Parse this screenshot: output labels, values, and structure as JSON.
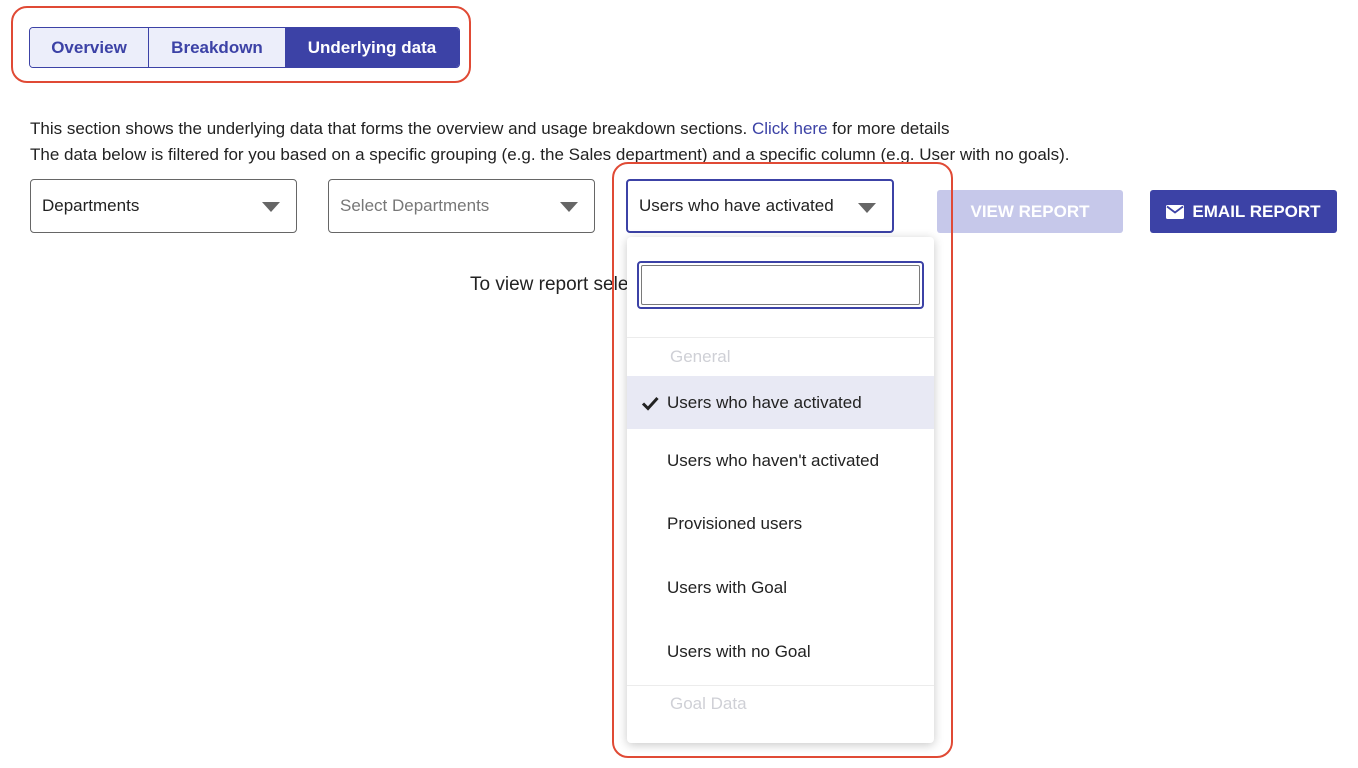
{
  "tabs": {
    "overview": "Overview",
    "breakdown": "Breakdown",
    "underlying": "Underlying data"
  },
  "description": {
    "line1_before": "This section shows the underlying data that forms the overview and usage breakdown sections.",
    "link": "Click here",
    "line1_after": "for more details",
    "line2": "The data below is filtered for you based on a specific grouping (e.g. the Sales department) and a specific column (e.g. User with no goals)."
  },
  "filters": {
    "grouping": "Departments",
    "group_value_placeholder": "Select Departments",
    "column": "Users who have activated"
  },
  "buttons": {
    "view_report": "VIEW REPORT",
    "email_report": "EMAIL REPORT"
  },
  "hint": "To view report select",
  "dropdown": {
    "search_value": "",
    "group_general": "General",
    "items": [
      "Users who have activated",
      "Users who haven't activated",
      "Provisioned users",
      "Users with Goal",
      "Users with no Goal"
    ],
    "selected_index": 0,
    "group_goal": "Goal Data"
  },
  "colors": {
    "accent": "#3c42a6",
    "disabled_button": "#c6c8ea",
    "annotation": "#e04a35"
  },
  "icons": {
    "caret": "caret-down-icon",
    "check": "check-icon",
    "envelope": "envelope-icon"
  }
}
